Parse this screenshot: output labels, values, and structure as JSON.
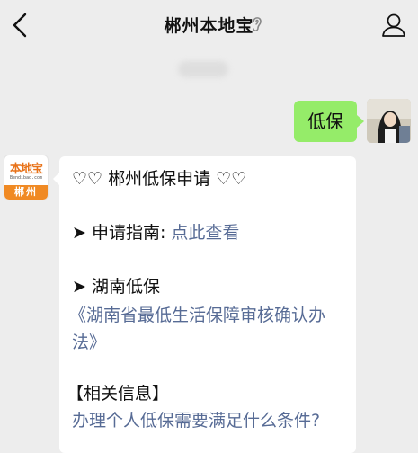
{
  "header": {
    "title": "郴州本地宝",
    "back_glyph": "‹"
  },
  "my_message": {
    "text": "低保"
  },
  "bot": {
    "logo_text": "本地宝",
    "logo_url": "Bendibao.com",
    "logo_city": "郴州"
  },
  "bot_message": {
    "line1": "♡♡ 郴州低保申请 ♡♡",
    "guide_label": "➤ 申请指南: ",
    "guide_link": "点此查看",
    "hunan_label": "➤ 湖南低保",
    "doc_link_line1": "《湖南省最低生活保障审核确认办",
    "doc_link_line2": "法》",
    "related_label": "【相关信息】",
    "related_link": "办理个人低保需要满足什么条件?"
  },
  "colors": {
    "background": "#ededed",
    "my_bubble": "#95ec69",
    "link": "#576b95",
    "logo_orange": "#f08a24"
  }
}
